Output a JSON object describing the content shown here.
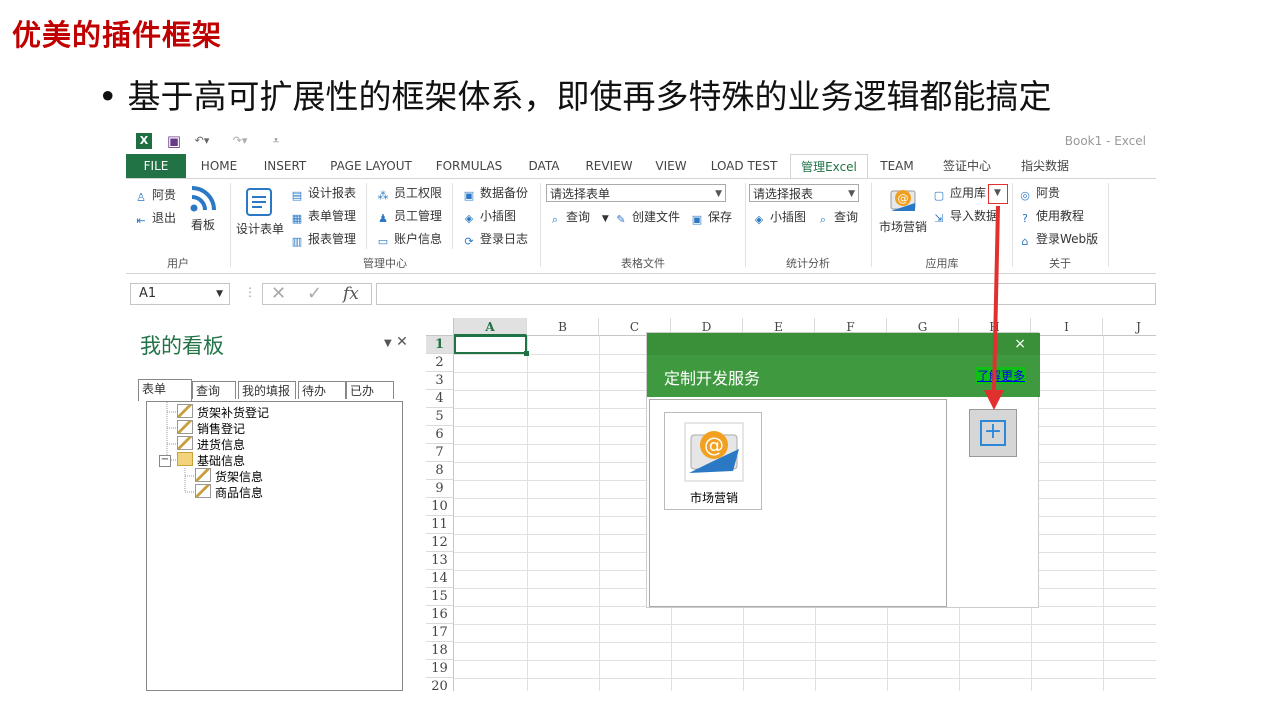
{
  "slide": {
    "title": "优美的插件框架",
    "bullet": "基于高可扩展性的框架体系，即使再多特殊的业务逻辑都能搞定"
  },
  "excel": {
    "window_title": "Book1 - Excel",
    "tabs": [
      "FILE",
      "HOME",
      "INSERT",
      "PAGE LAYOUT",
      "FORMULAS",
      "DATA",
      "REVIEW",
      "VIEW",
      "LOAD TEST",
      "管理Excel",
      "TEAM",
      "签证中心",
      "指尖数据"
    ],
    "active_tab": "管理Excel",
    "ribbon": {
      "user": {
        "label": "用户",
        "items": [
          "阿贵",
          "退出"
        ],
        "big": "看板"
      },
      "admin": {
        "label": "管理中心",
        "big": "设计表单",
        "col1": [
          "设计报表",
          "表单管理",
          "报表管理"
        ],
        "col2": [
          "员工权限",
          "员工管理",
          "账户信息"
        ],
        "col3": [
          "数据备份",
          "小插图",
          "登录日志"
        ]
      },
      "table_file": {
        "label": "表格文件",
        "combo": "请选择表单",
        "items": [
          "查询",
          "创建文件",
          "保存"
        ]
      },
      "stats": {
        "label": "统计分析",
        "combo": "请选择报表",
        "items": [
          "小插图",
          "查询"
        ]
      },
      "app_store": {
        "label": "应用库",
        "big": "市场营销",
        "items": [
          "应用库",
          "导入数据"
        ]
      },
      "about": {
        "label": "关于",
        "items": [
          "阿贵",
          "使用教程",
          "登录Web版"
        ]
      }
    },
    "name_box": "A1",
    "fx": "fx",
    "columns": [
      "A",
      "B",
      "C",
      "D",
      "E",
      "F",
      "G",
      "H",
      "I",
      "J"
    ],
    "rows": [
      "1",
      "2",
      "3",
      "4",
      "5",
      "6",
      "7",
      "8",
      "9",
      "10",
      "11",
      "12",
      "13",
      "14",
      "15",
      "16",
      "17",
      "18",
      "19",
      "20"
    ]
  },
  "kanban": {
    "title": "我的看板",
    "tabs": [
      "表单",
      "查询",
      "我的填报",
      "待办",
      "已办"
    ],
    "tree": [
      "货架补货登记",
      "销售登记",
      "进货信息",
      "基础信息",
      "货架信息",
      "商品信息"
    ]
  },
  "dialog": {
    "title": "定制开发服务",
    "more_link": "了解更多",
    "close": "×",
    "app_tile": "市场营销",
    "add": "+"
  },
  "colors": {
    "excel_green": "#217346",
    "dialog_green": "#3f9a3f",
    "title_red": "#c00000",
    "arrow_red": "#e03030"
  }
}
